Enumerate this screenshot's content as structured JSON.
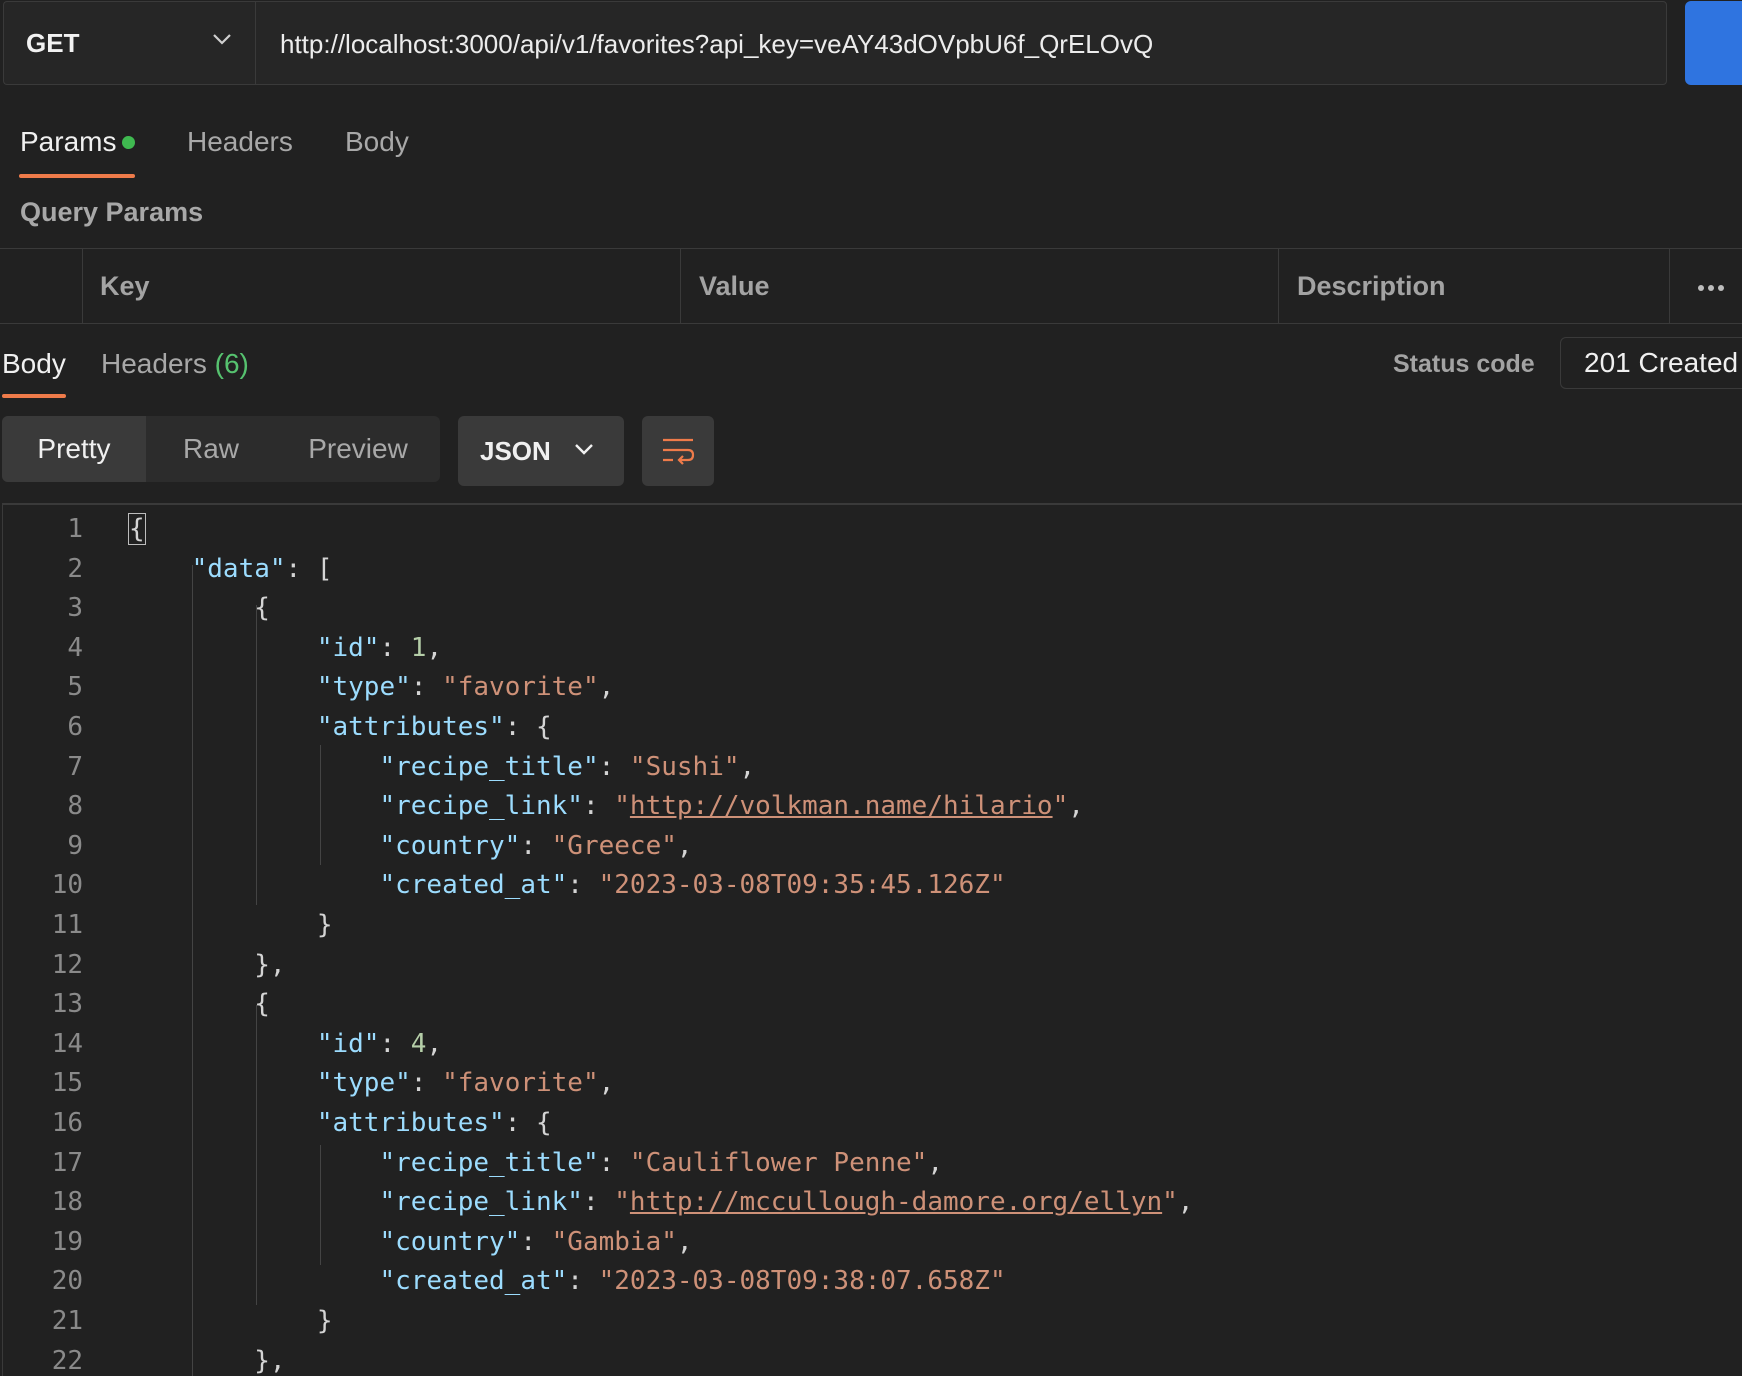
{
  "request": {
    "method": "GET",
    "url": "http://localhost:3000/api/v1/favorites?api_key=veAY43dOVpbU6f_QrELOvQ",
    "send_label": ""
  },
  "request_tabs": [
    {
      "label": "Params",
      "active": true,
      "has_dot": true
    },
    {
      "label": "Headers",
      "active": false
    },
    {
      "label": "Body",
      "active": false
    }
  ],
  "query_params": {
    "title": "Query Params",
    "columns": [
      "Key",
      "Value",
      "Description"
    ],
    "more_icon": "more-horizontal-icon"
  },
  "response": {
    "tabs": [
      {
        "label": "Body",
        "active": true
      },
      {
        "label": "Headers",
        "count": "(6)",
        "active": false
      }
    ],
    "status_label": "Status code",
    "status_value": "201 Created",
    "view_modes": [
      "Pretty",
      "Raw",
      "Preview"
    ],
    "active_view": "Pretty",
    "format": "JSON",
    "wrap_icon": "wrap-lines-icon"
  },
  "code_lines": [
    "{",
    "    \"data\": [",
    "        {",
    "            \"id\": 1,",
    "            \"type\": \"favorite\",",
    "            \"attributes\": {",
    "                \"recipe_title\": \"Sushi\",",
    "                \"recipe_link\": \"http://volkman.name/hilario\",",
    "                \"country\": \"Greece\",",
    "                \"created_at\": \"2023-03-08T09:35:45.126Z\"",
    "            }",
    "        },",
    "        {",
    "            \"id\": 4,",
    "            \"type\": \"favorite\",",
    "            \"attributes\": {",
    "                \"recipe_title\": \"Cauliflower Penne\",",
    "                \"recipe_link\": \"http://mccullough-damore.org/ellyn\",",
    "                \"country\": \"Gambia\",",
    "                \"created_at\": \"2023-03-08T09:38:07.658Z\"",
    "            }",
    "        },"
  ],
  "colors": {
    "accent": "#ef7b4a",
    "send": "#2f74e0",
    "dot": "#3fb950",
    "json_key": "#9cdcfe",
    "json_string": "#ce9178",
    "json_number": "#b5cea8"
  }
}
